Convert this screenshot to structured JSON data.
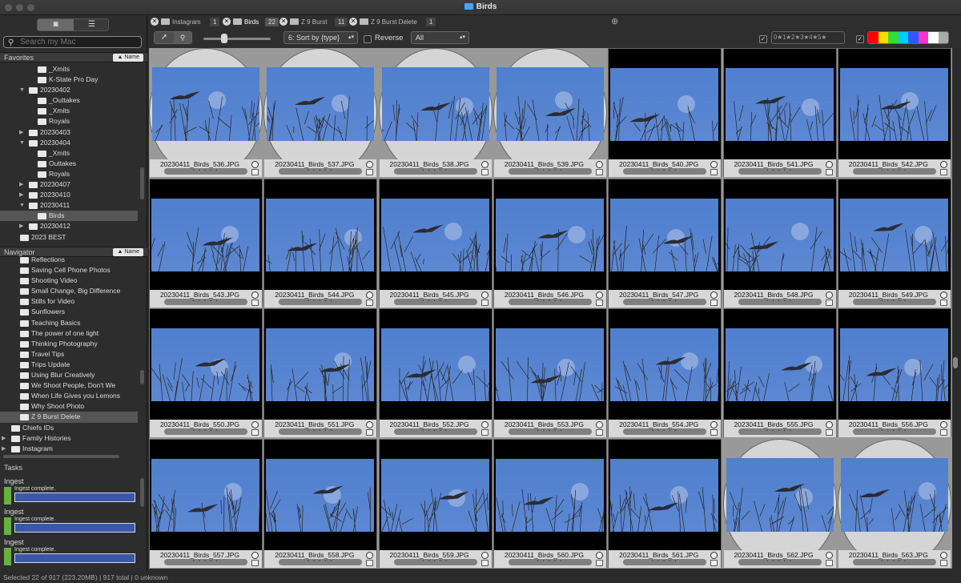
{
  "window": {
    "title": "Birds"
  },
  "sidebar": {
    "search_placeholder": "Search my Mac",
    "favorites": {
      "title": "Favorites",
      "sort_label": "▲ Name",
      "items": [
        {
          "label": "_Xmits",
          "depth": 4,
          "arrow": ""
        },
        {
          "label": "K-State Pro Day",
          "depth": 4,
          "arrow": ""
        },
        {
          "label": "20230402",
          "depth": 3,
          "arrow": "open"
        },
        {
          "label": "_Outtakes",
          "depth": 4,
          "arrow": ""
        },
        {
          "label": "_Xmits",
          "depth": 4,
          "arrow": ""
        },
        {
          "label": "Royals",
          "depth": 4,
          "arrow": ""
        },
        {
          "label": "20230403",
          "depth": 3,
          "arrow": "closed"
        },
        {
          "label": "20230404",
          "depth": 3,
          "arrow": "open"
        },
        {
          "label": "_Xmits",
          "depth": 4,
          "arrow": ""
        },
        {
          "label": "Outtakes",
          "depth": 4,
          "arrow": ""
        },
        {
          "label": "Royals",
          "depth": 4,
          "arrow": ""
        },
        {
          "label": "20230407",
          "depth": 3,
          "arrow": "closed"
        },
        {
          "label": "20230410",
          "depth": 3,
          "arrow": "closed"
        },
        {
          "label": "20230411",
          "depth": 3,
          "arrow": "open"
        },
        {
          "label": "Birds",
          "depth": 4,
          "arrow": "",
          "selected": true
        },
        {
          "label": "20230412",
          "depth": 3,
          "arrow": "closed"
        },
        {
          "label": "2023 BEST",
          "depth": 2,
          "arrow": ""
        }
      ]
    },
    "navigator": {
      "title": "Navigator",
      "sort_label": "▲ Name",
      "items": [
        {
          "label": "Reflections",
          "depth": 2,
          "arrow": ""
        },
        {
          "label": "Saving Cell Phone Photos",
          "depth": 2,
          "arrow": ""
        },
        {
          "label": "Shooting Video",
          "depth": 2,
          "arrow": ""
        },
        {
          "label": "Small Change, Big Difference",
          "depth": 2,
          "arrow": ""
        },
        {
          "label": "Stills for Video",
          "depth": 2,
          "arrow": ""
        },
        {
          "label": "Sunflowers",
          "depth": 2,
          "arrow": ""
        },
        {
          "label": "Teaching Basics",
          "depth": 2,
          "arrow": ""
        },
        {
          "label": "The power of one light",
          "depth": 2,
          "arrow": ""
        },
        {
          "label": "Thinking Photography",
          "depth": 2,
          "arrow": ""
        },
        {
          "label": "Travel Tips",
          "depth": 2,
          "arrow": ""
        },
        {
          "label": "Trips Update",
          "depth": 2,
          "arrow": ""
        },
        {
          "label": "Using Blur Creatively",
          "depth": 2,
          "arrow": ""
        },
        {
          "label": "We Shoot People, Don't We",
          "depth": 2,
          "arrow": ""
        },
        {
          "label": "When Life Gives you Lemons",
          "depth": 2,
          "arrow": ""
        },
        {
          "label": "Why Shoot Photo",
          "depth": 2,
          "arrow": ""
        },
        {
          "label": "Z 9 Burst Delete",
          "depth": 2,
          "arrow": "",
          "selected": true
        },
        {
          "label": "Chiefs IDs",
          "depth": 1,
          "arrow": ""
        },
        {
          "label": "Family Histories",
          "depth": 1,
          "arrow": "closed"
        },
        {
          "label": "Instagram",
          "depth": 1,
          "arrow": "closed"
        }
      ]
    },
    "tasks": {
      "title": "Tasks",
      "items": [
        {
          "name": "Ingest",
          "message": "Ingest complete.",
          "progress": 1.0
        },
        {
          "name": "Ingest",
          "message": "Ingest complete.",
          "progress": 1.0
        },
        {
          "name": "Ingest",
          "message": "Ingest complete.",
          "progress": 1.0
        }
      ]
    }
  },
  "tabs": [
    {
      "label": "Instagram",
      "count": "1",
      "active": false
    },
    {
      "label": "Birds",
      "count": "22",
      "active": true
    },
    {
      "label": "Z 9 Burst",
      "count": "11",
      "active": false
    },
    {
      "label": "Z 9 Burst Delete",
      "count": "1",
      "active": false
    }
  ],
  "toolbar": {
    "sort_label": "6: Sort by {type}",
    "reverse_label": "Reverse",
    "filter_label": "All",
    "rating_filter": "0★1★2★3★4★5★",
    "color_labels": [
      "#ff0000",
      "#ffdd00",
      "#33dd33",
      "#00ccff",
      "#3355ff",
      "#ff33cc",
      "#ffffff",
      "#aaaaaa"
    ]
  },
  "thumbnails": [
    {
      "file": "20230411_Birds_536.JPG",
      "selected": false
    },
    {
      "file": "20230411_Birds_537.JPG",
      "selected": false
    },
    {
      "file": "20230411_Birds_538.JPG",
      "selected": false
    },
    {
      "file": "20230411_Birds_539.JPG",
      "selected": false
    },
    {
      "file": "20230411_Birds_540.JPG",
      "selected": true
    },
    {
      "file": "20230411_Birds_541.JPG",
      "selected": true
    },
    {
      "file": "20230411_Birds_542.JPG",
      "selected": true
    },
    {
      "file": "20230411_Birds_543.JPG",
      "selected": true
    },
    {
      "file": "20230411_Birds_544.JPG",
      "selected": true
    },
    {
      "file": "20230411_Birds_545.JPG",
      "selected": true
    },
    {
      "file": "20230411_Birds_546.JPG",
      "selected": true
    },
    {
      "file": "20230411_Birds_547.JPG",
      "selected": true
    },
    {
      "file": "20230411_Birds_548.JPG",
      "selected": true
    },
    {
      "file": "20230411_Birds_549.JPG",
      "selected": true
    },
    {
      "file": "20230411_Birds_550.JPG",
      "selected": true
    },
    {
      "file": "20230411_Birds_551.JPG",
      "selected": true
    },
    {
      "file": "20230411_Birds_552.JPG",
      "selected": true
    },
    {
      "file": "20230411_Birds_553.JPG",
      "selected": true
    },
    {
      "file": "20230411_Birds_554.JPG",
      "selected": true
    },
    {
      "file": "20230411_Birds_555.JPG",
      "selected": true
    },
    {
      "file": "20230411_Birds_556.JPG",
      "selected": true
    },
    {
      "file": "20230411_Birds_557.JPG",
      "selected": true
    },
    {
      "file": "20230411_Birds_558.JPG",
      "selected": true
    },
    {
      "file": "20230411_Birds_559.JPG",
      "selected": true
    },
    {
      "file": "20230411_Birds_560.JPG",
      "selected": true
    },
    {
      "file": "20230411_Birds_561.JPG",
      "selected": true
    },
    {
      "file": "20230411_Birds_562.JPG",
      "selected": false
    },
    {
      "file": "20230411_Birds_563.JPG",
      "selected": false
    }
  ],
  "status": "Selected 22 of 917 (223.20MB) | 917 total | 0 unknown"
}
